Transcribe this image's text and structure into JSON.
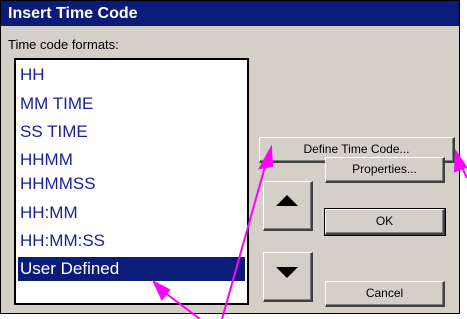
{
  "dialog": {
    "title": "Insert Time Code",
    "formats_label": "Time code formats:",
    "formats": [
      "HH",
      "MM TIME",
      "SS TIME",
      "HHMM",
      "HHMMSS",
      "HH:MM",
      "HH:MM:SS",
      "User Defined"
    ],
    "selected_index": 7,
    "buttons": {
      "define": "Define Time Code...",
      "properties": "Properties...",
      "ok": "OK",
      "cancel": "Cancel"
    },
    "move_up_icon": "triangle-up-icon",
    "move_down_icon": "triangle-down-icon"
  },
  "colors": {
    "title_bar": "#0a1c78",
    "selection": "#0a1c78",
    "list_text": "#1a1f95",
    "face": "#d4d0c8",
    "callout": "#ff00ff"
  }
}
